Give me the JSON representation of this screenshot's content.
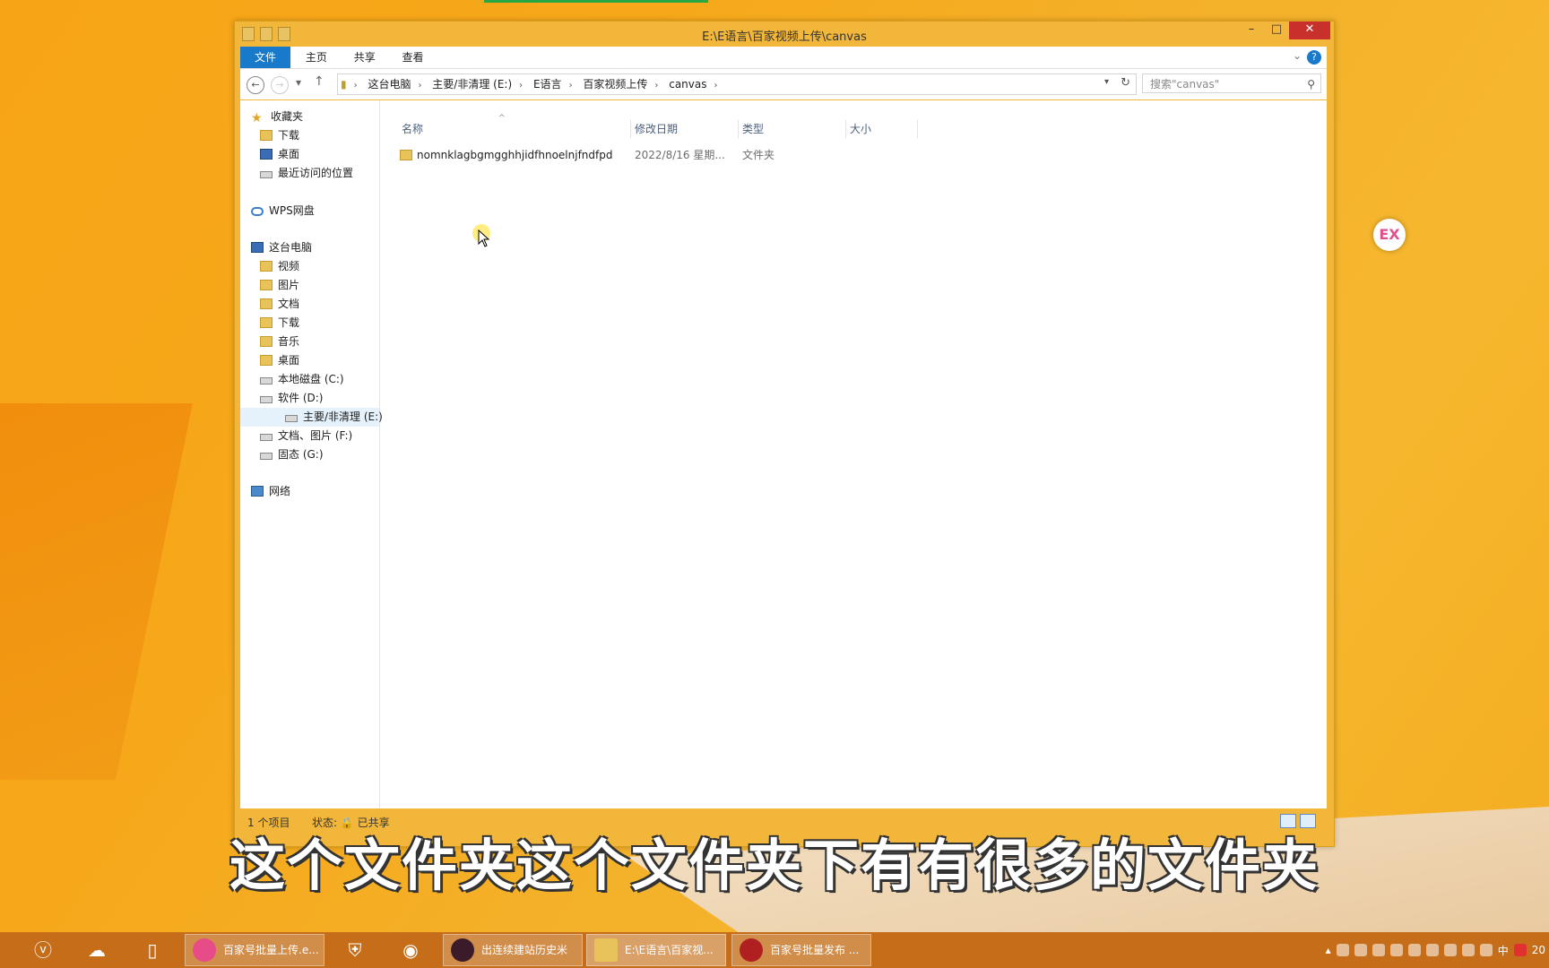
{
  "window": {
    "title": "E:\\E语言\\百家视频上传\\canvas",
    "controls": {
      "minimize": "–",
      "maximize": "□",
      "close": "✕"
    }
  },
  "ribbon": {
    "tabs": [
      "文件",
      "主页",
      "共享",
      "查看"
    ],
    "help": "?"
  },
  "navigation": {
    "back": "←",
    "forward": "→",
    "recent": "▾",
    "up": "↑",
    "breadcrumbs": [
      "这台电脑",
      "主要/非清理 (E:)",
      "E语言",
      "百家视频上传",
      "canvas"
    ],
    "refresh": "↻",
    "search_placeholder": "搜索\"canvas\""
  },
  "tree": {
    "favorites": {
      "label": "收藏夹",
      "items": [
        "下载",
        "桌面",
        "最近访问的位置"
      ]
    },
    "wps": {
      "label": "WPS网盘"
    },
    "pc": {
      "label": "这台电脑",
      "items": [
        "视频",
        "图片",
        "文档",
        "下载",
        "音乐",
        "桌面",
        "本地磁盘 (C:)",
        "软件 (D:)",
        "主要/非清理 (E:)",
        "文档、图片 (F:)",
        "固态 (G:)"
      ],
      "selected": "主要/非清理 (E:)"
    },
    "network": {
      "label": "网络"
    }
  },
  "columns": [
    "名称",
    "修改日期",
    "类型",
    "大小"
  ],
  "files": [
    {
      "name": "nomnklagbgmgghhjidfhnoelnjfndfpd",
      "modified": "2022/8/16 星期...",
      "type": "文件夹",
      "size": ""
    }
  ],
  "status": {
    "count": "1 个项目",
    "state": "状态: 🔒 已共享"
  },
  "caption": "这个文件夹这个文件夹下有有很多的文件夹",
  "badge": "EX",
  "taskbar": {
    "tasks": [
      {
        "label": "百家号批量上传.e...",
        "color": "#e84c88"
      },
      {
        "label": "出连续建站历史米",
        "color": "#3b1a2a"
      },
      {
        "label": "E:\\E语言\\百家视...",
        "color": "#e8c35a"
      },
      {
        "label": "百家号批量发布 ...",
        "color": "#b02020"
      }
    ],
    "tray": {
      "ime": "中",
      "clock": "20"
    }
  }
}
